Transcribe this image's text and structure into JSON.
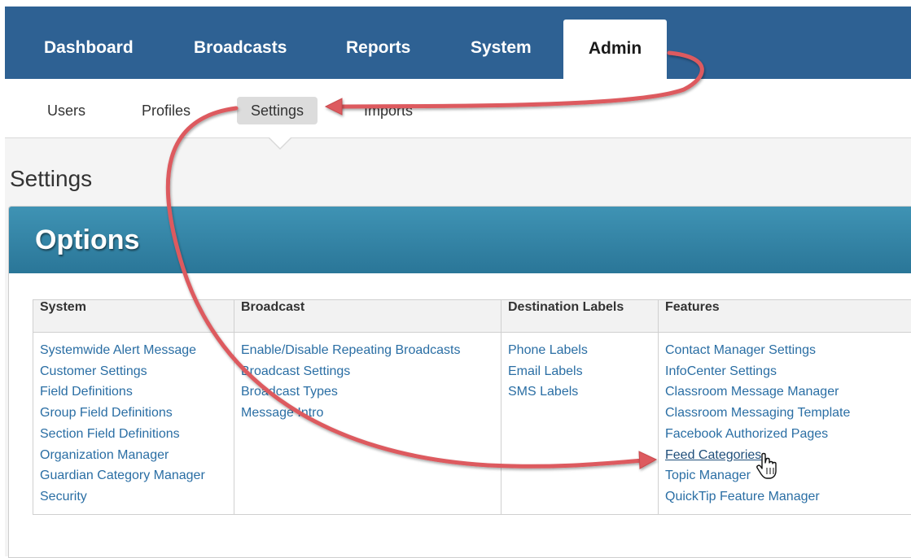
{
  "topnav": {
    "tabs": [
      {
        "label": "Dashboard"
      },
      {
        "label": "Broadcasts"
      },
      {
        "label": "Reports"
      },
      {
        "label": "System"
      },
      {
        "label": "Admin",
        "active": true
      }
    ]
  },
  "subnav": {
    "items": [
      {
        "label": "Users"
      },
      {
        "label": "Profiles"
      },
      {
        "label": "Settings",
        "active": true
      },
      {
        "label": "Imports"
      }
    ]
  },
  "page": {
    "title": "Settings"
  },
  "options": {
    "heading": "Options",
    "columns": [
      {
        "header": "System",
        "links": [
          "Systemwide Alert Message",
          "Customer Settings",
          "Field Definitions",
          "Group Field Definitions",
          "Section Field Definitions",
          "Organization Manager",
          "Guardian Category Manager",
          "Security"
        ]
      },
      {
        "header": "Broadcast",
        "links": [
          "Enable/Disable Repeating Broadcasts",
          "Broadcast Settings",
          "Broadcast Types",
          "Message Intro"
        ]
      },
      {
        "header": "Destination Labels",
        "links": [
          "Phone Labels",
          "Email Labels",
          "SMS Labels"
        ]
      },
      {
        "header": "Features",
        "links": [
          "Contact Manager Settings",
          "InfoCenter Settings",
          "Classroom Message Manager",
          "Classroom Messaging Template",
          "Facebook Authorized Pages",
          "Feed Categories",
          "Topic Manager",
          "QuickTip Feature Manager"
        ]
      }
    ]
  },
  "colors": {
    "nav": "#2e6193",
    "panel": "#2f7fa1",
    "link": "#2a6ea4",
    "arrow": "#dd5a5e"
  },
  "icons": {
    "cursor": "hand-pointer-icon"
  }
}
